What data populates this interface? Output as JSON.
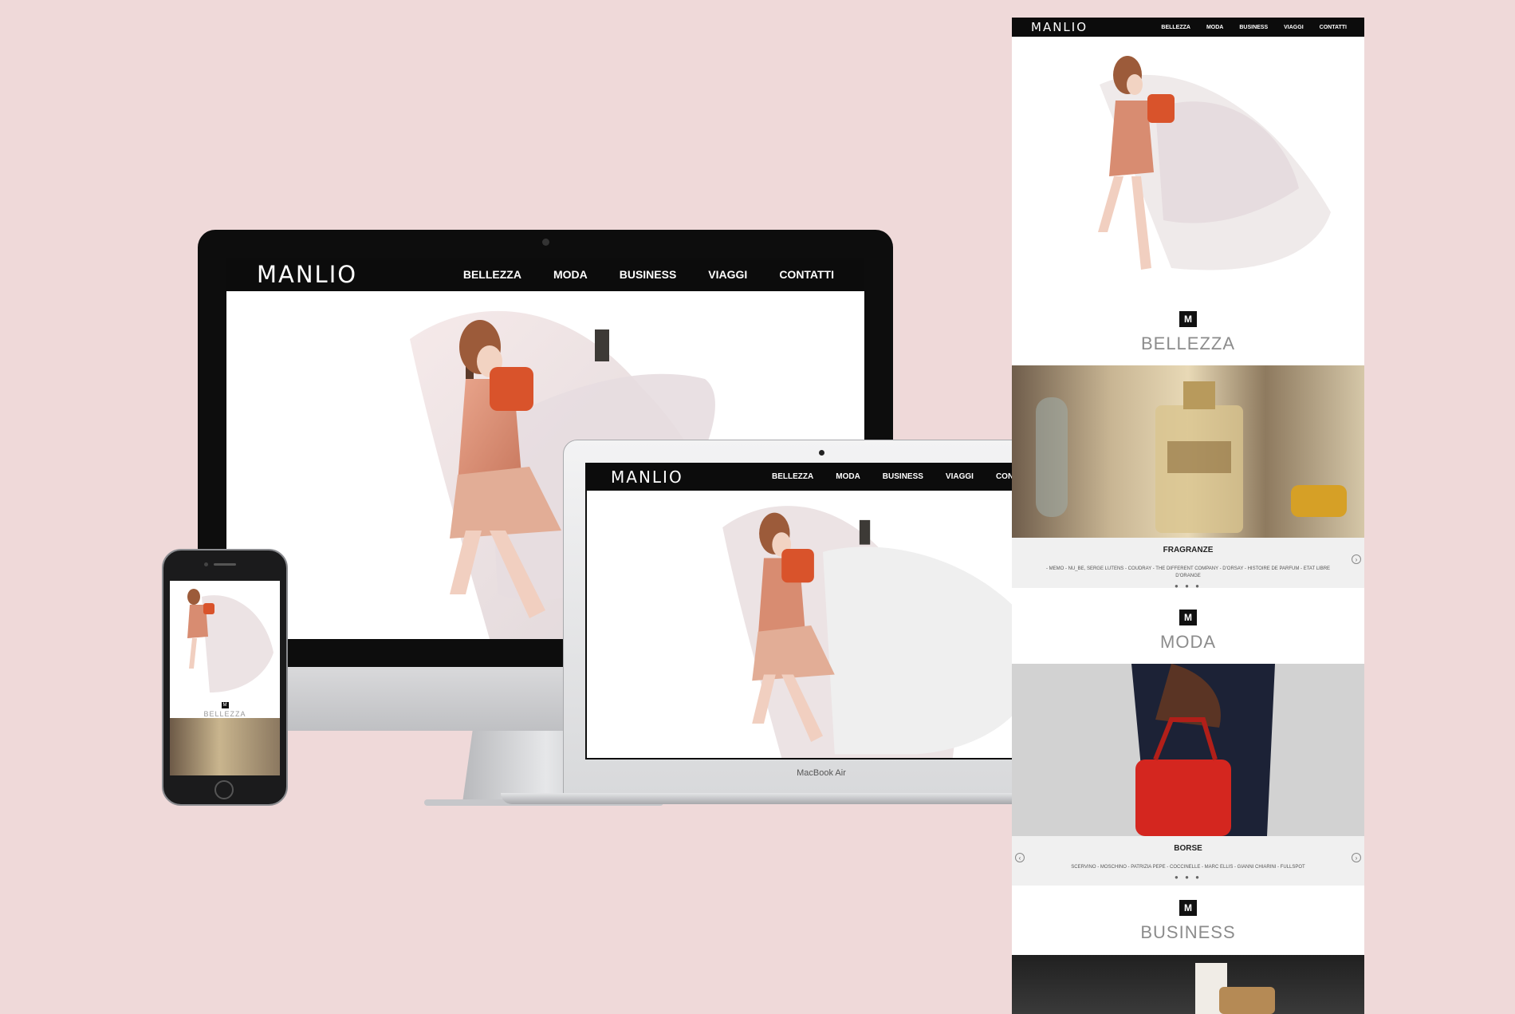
{
  "colors": {
    "background": "#efd9d9",
    "nav": "#0c0c0c",
    "accent_bag": "#d9532b"
  },
  "brand": {
    "logo": "MANLIO"
  },
  "nav": {
    "items": [
      "BELLEZZA",
      "MODA",
      "BUSINESS",
      "VIAGGI",
      "CONTATTI"
    ]
  },
  "laptop": {
    "label": "MacBook Air"
  },
  "phone": {
    "section_title": "BELLEZZA",
    "badge": "M"
  },
  "longpage": {
    "badge": "M",
    "sections": [
      {
        "title": "BELLEZZA",
        "caption": "FRAGRANZE",
        "brands": "- MEMO - NU_BE, SERGE LUTENS - COUDRAY - THE DIFFERENT COMPANY - D'ORSAY - HISTOIRE DE PARFUM - ETAT LIBRE D'ORANGE",
        "dots": "● ● ●"
      },
      {
        "title": "MODA",
        "caption": "BORSE",
        "brands": "SCERVINO - MOSCHINO - PATRIZIA PEPE - COCCINELLE - MARC ELLIS - GIANNI CHIARINI - FULLSPOT",
        "dots": "● ● ●"
      },
      {
        "title": "BUSINESS"
      }
    ],
    "arrow_left": "‹",
    "arrow_right": "›"
  }
}
